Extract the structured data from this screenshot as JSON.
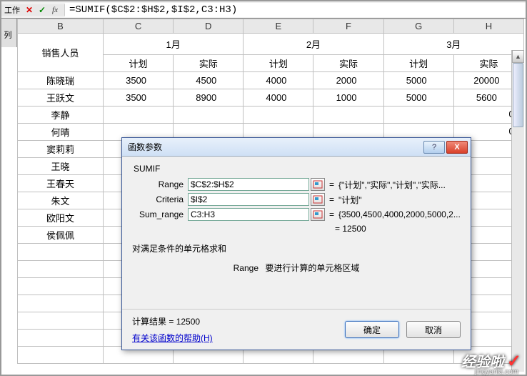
{
  "formula_bar": {
    "left_text": "工作",
    "left_text2": "列",
    "formula": "=SUMIF($C$2:$H$2,$I$2,C3:H3)"
  },
  "columns": [
    "B",
    "C",
    "D",
    "E",
    "F",
    "G",
    "H"
  ],
  "header": {
    "sales_label": "销售人员",
    "months": [
      "1月",
      "2月",
      "3月"
    ],
    "sub": {
      "plan": "计划",
      "actual": "实际"
    }
  },
  "rows": [
    {
      "name": "陈晓瑞",
      "vals": [
        "3500",
        "4500",
        "4000",
        "2000",
        "5000",
        "20000"
      ]
    },
    {
      "name": "王跃文",
      "vals": [
        "3500",
        "8900",
        "4000",
        "1000",
        "5000",
        "5600"
      ]
    },
    {
      "name": "李静",
      "vals": [
        "",
        "",
        "",
        "",
        "",
        ""
      ]
    },
    {
      "name": "何晴",
      "vals": [
        "",
        "",
        "",
        "",
        "",
        ""
      ]
    },
    {
      "name": "窦莉莉",
      "vals": [
        "",
        "",
        "",
        "",
        "",
        ""
      ]
    },
    {
      "name": "王晓",
      "vals": [
        "",
        "",
        "",
        "",
        "",
        ""
      ]
    },
    {
      "name": "王春天",
      "vals": [
        "",
        "",
        "",
        "",
        "",
        ""
      ]
    },
    {
      "name": "朱文",
      "vals": [
        "",
        "",
        "",
        "",
        "",
        ""
      ]
    },
    {
      "name": "欧阳文",
      "vals": [
        "",
        "",
        "",
        "",
        "",
        ""
      ]
    },
    {
      "name": "侯佩佩",
      "vals": [
        "",
        "",
        "",
        "",
        "",
        ""
      ]
    }
  ],
  "dialog": {
    "title": "函数参数",
    "help_btn": "?",
    "close_btn": "X",
    "func_name": "SUMIF",
    "params": [
      {
        "label": "Range",
        "value": "$C$2:$H$2",
        "preview": "{\"计划\",\"实际\",\"计划\",\"实际..."
      },
      {
        "label": "Criteria",
        "value": "$I$2",
        "preview": "\"计划\""
      },
      {
        "label": "Sum_range",
        "value": "C3:H3",
        "preview": "{3500,4500,4000,2000,5000,2..."
      }
    ],
    "result_inline": "= 12500",
    "desc1": "对满足条件的单元格求和",
    "desc2_label": "Range",
    "desc2_text": "要进行计算的单元格区域",
    "calc_result_label": "计算结果 = ",
    "calc_result_value": "12500",
    "help_link": "有关该函数的帮助(H)",
    "ok": "确定",
    "cancel": "取消"
  },
  "watermark": {
    "main": "经验啦",
    "sub": "jingyanla.com"
  }
}
